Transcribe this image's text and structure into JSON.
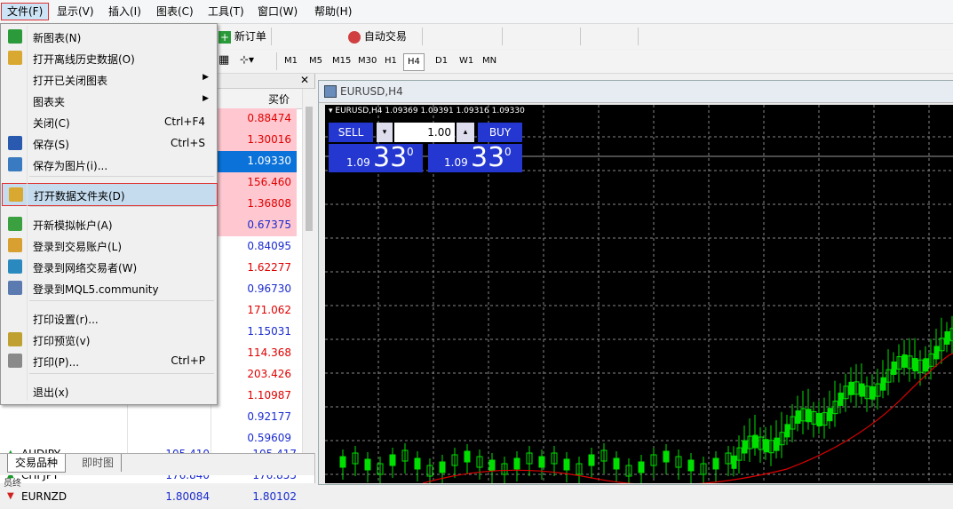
{
  "menubar": {
    "items": [
      "文件(F)",
      "显示(V)",
      "插入(I)",
      "图表(C)",
      "工具(T)",
      "窗口(W)",
      "帮助(H)"
    ]
  },
  "toolbar": {
    "new_order": "新订单",
    "auto_trade": "自动交易",
    "timeframes": [
      "M1",
      "M5",
      "M15",
      "M30",
      "H1",
      "H4",
      "D1",
      "W1",
      "MN"
    ]
  },
  "file_menu": {
    "items": [
      {
        "label": "新图表(N)",
        "shortcut": "",
        "icon": "new-chart-icon"
      },
      {
        "label": "打开离线历史数据(O)",
        "shortcut": "",
        "icon": "open-folder-icon"
      },
      {
        "label": "打开已关闭图表",
        "shortcut": "",
        "submenu": true
      },
      {
        "label": "图表夹",
        "shortcut": "",
        "submenu": true
      },
      {
        "label": "关闭(C)",
        "shortcut": "Ctrl+F4"
      },
      {
        "label": "保存(S)",
        "shortcut": "Ctrl+S",
        "icon": "save-icon"
      },
      {
        "label": "保存为图片(i)...",
        "shortcut": "",
        "icon": "save-image-icon"
      },
      {
        "label": "打开数据文件夹(D)",
        "shortcut": "",
        "icon": "folder-icon",
        "highlighted": true
      },
      {
        "label": "开新模拟帐户(A)",
        "shortcut": "",
        "icon": "new-account-icon"
      },
      {
        "label": "登录到交易账户(L)",
        "shortcut": "",
        "icon": "login-icon"
      },
      {
        "label": "登录到网络交易者(W)",
        "shortcut": "",
        "icon": "web-trader-icon"
      },
      {
        "label": "登录到MQL5.community",
        "shortcut": "",
        "icon": "mql5-icon"
      },
      {
        "label": "打印设置(r)...",
        "shortcut": ""
      },
      {
        "label": "打印预览(v)",
        "shortcut": "",
        "icon": "print-preview-icon"
      },
      {
        "label": "打印(P)...",
        "shortcut": "Ctrl+P",
        "icon": "printer-icon"
      },
      {
        "label": "退出(x)",
        "shortcut": ""
      }
    ]
  },
  "market_watch": {
    "ask_header": "买价",
    "ask_values": [
      "0.88474",
      "1.30016",
      "1.09330",
      "156.460",
      "1.36808",
      "0.67375",
      "0.84095",
      "1.62277",
      "0.96730",
      "171.062",
      "1.15031",
      "114.368",
      "203.426",
      "1.10987",
      "0.92177",
      "0.59609"
    ],
    "rows": [
      {
        "symbol": "AUDJPY",
        "bid": "105.410",
        "ask": "105.417"
      },
      {
        "symbol": "CHFJPY",
        "bid": "176.840",
        "ask": "176.855"
      },
      {
        "symbol": "EURNZD",
        "bid": "1.80084",
        "ask": "1.80102"
      }
    ],
    "tabs": [
      "交易品种",
      "即时图"
    ],
    "bottom_label": "员终"
  },
  "chart": {
    "window_title": "EURUSD,H4",
    "header_text": "EURUSD,H4  1.09369 1.09391 1.09316 1.09330",
    "sell_label": "SELL",
    "buy_label": "BUY",
    "lot": "1.00",
    "sell_price_small": "1.09",
    "sell_price_big": "33",
    "sell_price_sup": "0",
    "buy_price_small": "1.09",
    "buy_price_big": "33",
    "buy_price_sup": "0",
    "candle_color": "#00e000",
    "ma_color": "#e00000"
  }
}
